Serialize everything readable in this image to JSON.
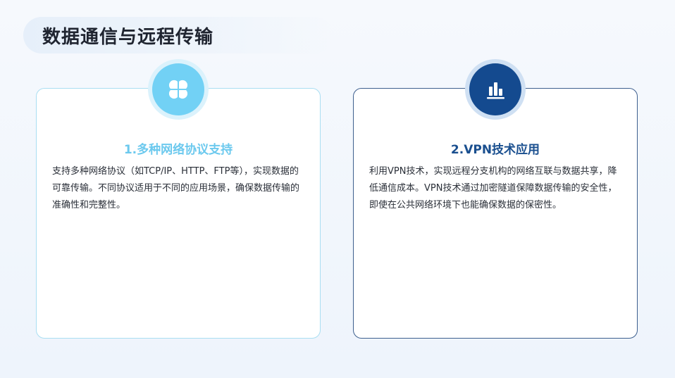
{
  "page": {
    "title": "数据通信与远程传输"
  },
  "cards": [
    {
      "title": "1.多种网络协议支持",
      "text": "支持多种网络协议（如TCP/IP、HTTP、FTP等），实现数据的可靠传输。不同协议适用于不同的应用场景，确保数据传输的准确性和完整性。",
      "icon": "clover-icon",
      "accent_color": "#72d1f5"
    },
    {
      "title": "2.VPN技术应用",
      "text": "利用VPN技术，实现远程分支机构的网络互联与数据共享，降低通信成本。VPN技术通过加密隧道保障数据传输的安全性，即使在公共网络环境下也能确保数据的保密性。",
      "icon": "bar-chart-icon",
      "accent_color": "#144a8f"
    }
  ]
}
